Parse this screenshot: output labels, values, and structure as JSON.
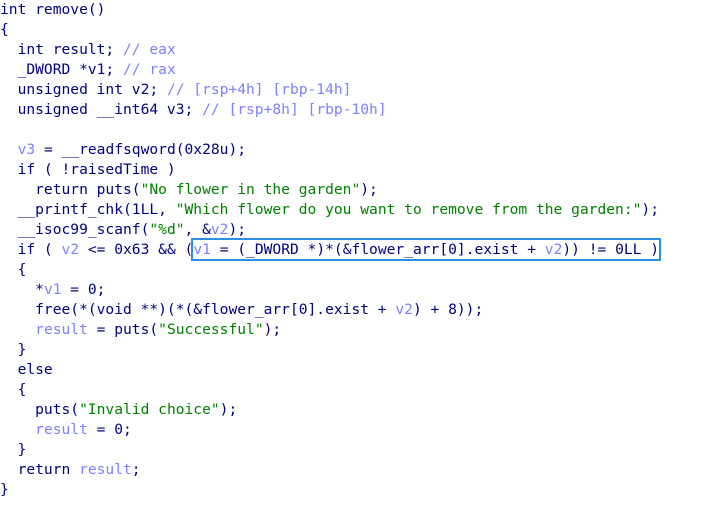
{
  "code_lines": [
    [
      {
        "t": "int remove()",
        "c": "sym"
      }
    ],
    [
      {
        "t": "{",
        "c": "sym"
      }
    ],
    [
      {
        "t": "  int result; ",
        "c": "kw"
      },
      {
        "t": "// eax",
        "c": "cmt"
      }
    ],
    [
      {
        "t": "  _DWORD *v1; ",
        "c": "kw"
      },
      {
        "t": "// rax",
        "c": "cmt"
      }
    ],
    [
      {
        "t": "  unsigned int v2; ",
        "c": "kw"
      },
      {
        "t": "// [rsp+4h] [rbp-14h]",
        "c": "cmt"
      }
    ],
    [
      {
        "t": "  unsigned __int64 v3; ",
        "c": "kw"
      },
      {
        "t": "// [rsp+8h] [rbp-10h]",
        "c": "cmt"
      }
    ],
    [
      {
        "t": "",
        "c": "sym"
      }
    ],
    [
      {
        "t": "  ",
        "c": "sym"
      },
      {
        "t": "v3",
        "c": "var"
      },
      {
        "t": " = __readfsqword(0x28u);",
        "c": "sym"
      }
    ],
    [
      {
        "t": "  if ( !raisedTime )",
        "c": "sym"
      }
    ],
    [
      {
        "t": "    return puts(",
        "c": "sym"
      },
      {
        "t": "\"No flower in the garden\"",
        "c": "str"
      },
      {
        "t": ");",
        "c": "sym"
      }
    ],
    [
      {
        "t": "  __printf_chk(1LL, ",
        "c": "sym"
      },
      {
        "t": "\"Which flower do you want to remove from the garden:\"",
        "c": "str"
      },
      {
        "t": ");",
        "c": "sym"
      }
    ],
    [
      {
        "t": "  __isoc99_scanf(",
        "c": "sym"
      },
      {
        "t": "\"%d\"",
        "c": "str"
      },
      {
        "t": ", &",
        "c": "sym"
      },
      {
        "t": "v2",
        "c": "var"
      },
      {
        "t": ");",
        "c": "sym"
      }
    ],
    [
      {
        "t": "  if ( ",
        "c": "sym"
      },
      {
        "t": "v2",
        "c": "var"
      },
      {
        "t": " <= 0x63 && (",
        "c": "sym"
      },
      {
        "t": "v1",
        "c": "var"
      },
      {
        "t": " = (_DWORD *)*(&flower_arr[0].exist + ",
        "c": "sym"
      },
      {
        "t": "v2",
        "c": "var"
      },
      {
        "t": ")) != 0LL )",
        "c": "sym"
      }
    ],
    [
      {
        "t": "  {",
        "c": "sym"
      }
    ],
    [
      {
        "t": "    *",
        "c": "sym"
      },
      {
        "t": "v1",
        "c": "var"
      },
      {
        "t": " = 0;",
        "c": "sym"
      }
    ],
    [
      {
        "t": "    free(*(void **)(*(&flower_arr[0].exist + ",
        "c": "sym"
      },
      {
        "t": "v2",
        "c": "var"
      },
      {
        "t": ") + 8));",
        "c": "sym"
      }
    ],
    [
      {
        "t": "    ",
        "c": "sym"
      },
      {
        "t": "result",
        "c": "var"
      },
      {
        "t": " = puts(",
        "c": "sym"
      },
      {
        "t": "\"Successful\"",
        "c": "str"
      },
      {
        "t": ");",
        "c": "sym"
      }
    ],
    [
      {
        "t": "  }",
        "c": "sym"
      }
    ],
    [
      {
        "t": "  else",
        "c": "sym"
      }
    ],
    [
      {
        "t": "  {",
        "c": "sym"
      }
    ],
    [
      {
        "t": "    puts(",
        "c": "sym"
      },
      {
        "t": "\"Invalid choice\"",
        "c": "str"
      },
      {
        "t": ");",
        "c": "sym"
      }
    ],
    [
      {
        "t": "    ",
        "c": "sym"
      },
      {
        "t": "result",
        "c": "var"
      },
      {
        "t": " = 0;",
        "c": "sym"
      }
    ],
    [
      {
        "t": "  }",
        "c": "sym"
      }
    ],
    [
      {
        "t": "  return ",
        "c": "sym"
      },
      {
        "t": "result",
        "c": "var"
      },
      {
        "t": ";",
        "c": "sym"
      }
    ],
    [
      {
        "t": "}",
        "c": "sym"
      }
    ]
  ],
  "highlight": {
    "line_index": 12,
    "color": "#2d8fe0"
  }
}
